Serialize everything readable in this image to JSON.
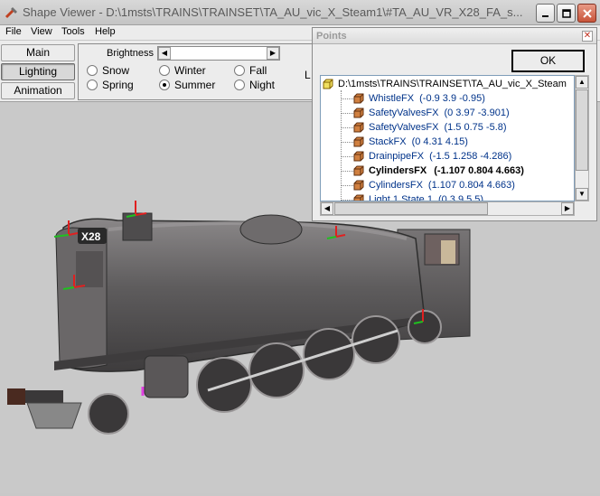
{
  "window": {
    "title": "Shape Viewer - D:\\1msts\\TRAINS\\TRAINSET\\TA_AU_vic_X_Steam1\\#TA_AU_VR_X28_FA_s...",
    "app_icon": "wrench-icon"
  },
  "menu": [
    "File",
    "View",
    "Tools",
    "Help"
  ],
  "side_buttons": [
    "Main",
    "Lighting",
    "Animation"
  ],
  "active_side_button": "Lighting",
  "brightness_label": "Brightness",
  "seasons": [
    {
      "label": "Snow",
      "checked": false
    },
    {
      "label": "Winter",
      "checked": false
    },
    {
      "label": "Fall",
      "checked": false
    },
    {
      "label": "Spring",
      "checked": false
    },
    {
      "label": "Summer",
      "checked": true
    },
    {
      "label": "Night",
      "checked": false
    }
  ],
  "clipped_label": "L",
  "locomotive_number": "X28",
  "points_dialog": {
    "title": "Points",
    "ok_label": "OK",
    "root_path": "D:\\1msts\\TRAINS\\TRAINSET\\TA_AU_vic_X_Steam",
    "points": [
      {
        "name": "WhistleFX",
        "coords": "(-0.9  3.9  -0.95)",
        "bold": false
      },
      {
        "name": "SafetyValvesFX",
        "coords": "(0  3.97  -3.901)",
        "bold": false
      },
      {
        "name": "SafetyValvesFX",
        "coords": "(1.5  0.75  -5.8)",
        "bold": false
      },
      {
        "name": "StackFX",
        "coords": "(0  4.31  4.15)",
        "bold": false
      },
      {
        "name": "DrainpipeFX",
        "coords": "(-1.5  1.258  -4.286)",
        "bold": false
      },
      {
        "name": "CylindersFX",
        "coords": "(-1.107  0.804  4.663)",
        "bold": true
      },
      {
        "name": "CylindersFX",
        "coords": "(1.107  0.804  4.663)",
        "bold": false
      },
      {
        "name": "Light 1 State 1",
        "coords": "(0  3.9  5.5)",
        "bold": false
      }
    ]
  },
  "colors": {
    "chrome": "#ececec",
    "viewport": "#c9c9c9",
    "tree_text": "#00338a",
    "close_button": "#c8543a",
    "locomotive_body": "#5e5c5d",
    "point_marker_red": "#e02020",
    "point_marker_green": "#20c020"
  }
}
